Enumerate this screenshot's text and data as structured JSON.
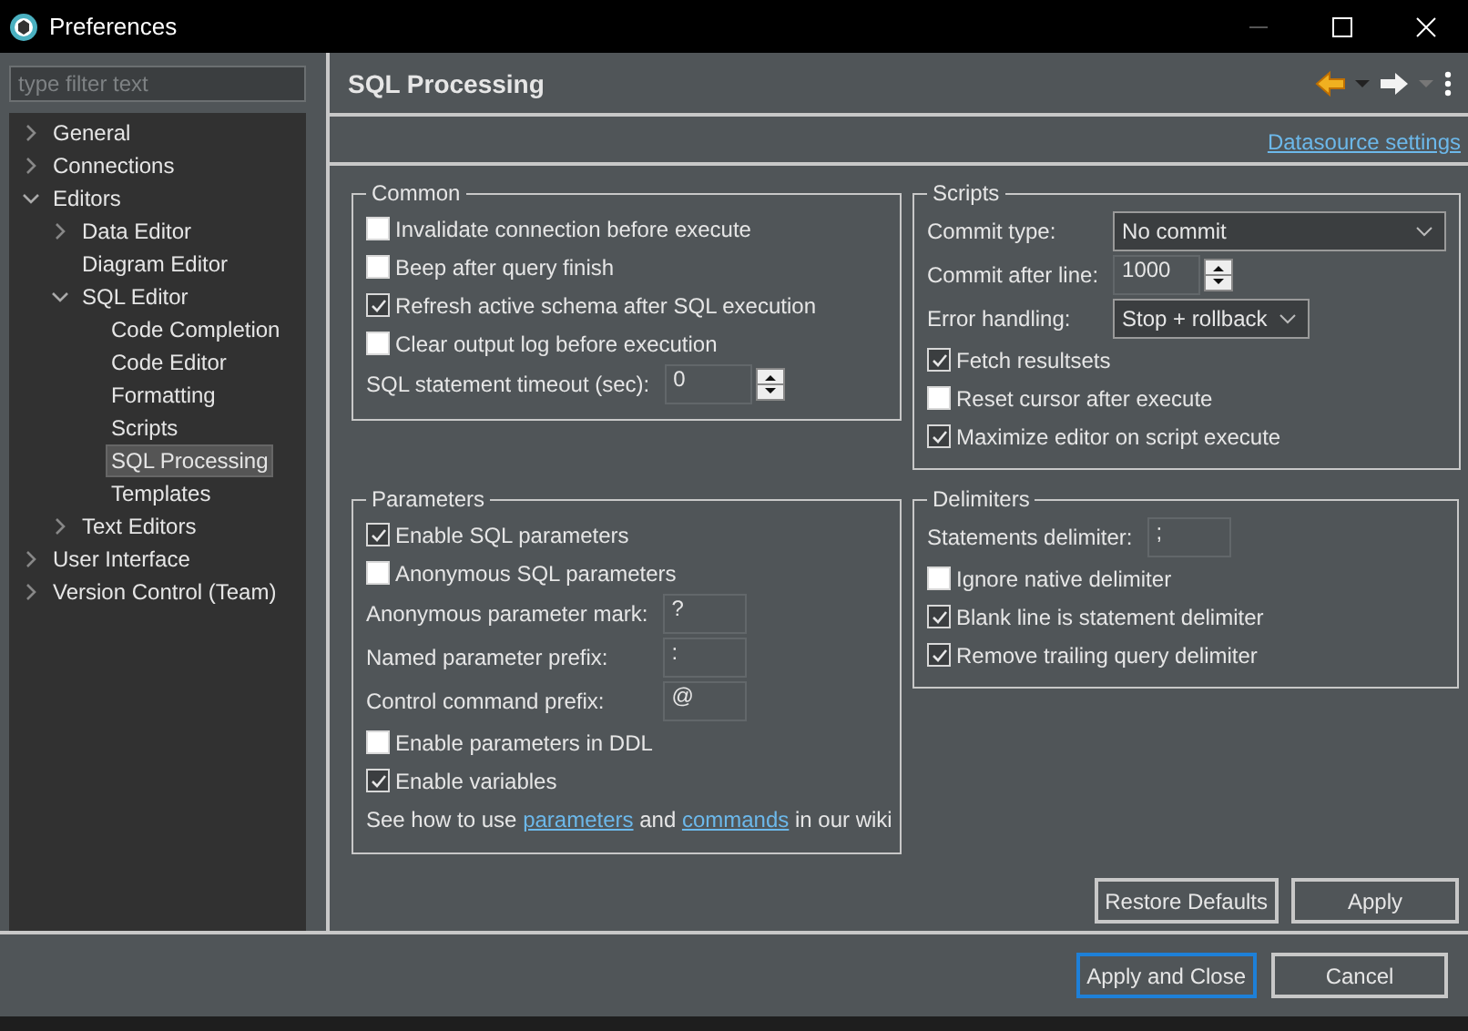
{
  "window": {
    "title": "Preferences"
  },
  "sidebar": {
    "filter": {
      "placeholder": "type filter text"
    },
    "tree": [
      {
        "label": "General",
        "expanded": false,
        "selected": false
      },
      {
        "label": "Connections",
        "expanded": false,
        "selected": false
      },
      {
        "label": "Editors",
        "expanded": true,
        "selected": false,
        "children": [
          {
            "label": "Data Editor",
            "expanded": false,
            "selected": false
          },
          {
            "label": "Diagram Editor",
            "selected": false
          },
          {
            "label": "SQL Editor",
            "expanded": true,
            "selected": false,
            "children": [
              {
                "label": "Code Completion",
                "selected": false
              },
              {
                "label": "Code Editor",
                "selected": false
              },
              {
                "label": "Formatting",
                "selected": false
              },
              {
                "label": "Scripts",
                "selected": false
              },
              {
                "label": "SQL Processing",
                "selected": true
              },
              {
                "label": "Templates",
                "selected": false
              }
            ]
          },
          {
            "label": "Text Editors",
            "expanded": false,
            "selected": false
          }
        ]
      },
      {
        "label": "User Interface",
        "expanded": false,
        "selected": false
      },
      {
        "label": "Version Control (Team)",
        "expanded": false,
        "selected": false
      }
    ]
  },
  "page": {
    "title": "SQL Processing",
    "link": "Datasource settings",
    "groups": [
      {
        "title": "Common",
        "items": [
          {
            "kind": "checkbox",
            "label": "Invalidate connection before execute",
            "checked": false
          },
          {
            "kind": "checkbox",
            "label": "Beep after query finish",
            "checked": false
          },
          {
            "kind": "checkbox",
            "label": "Refresh active schema after SQL execution",
            "checked": true
          },
          {
            "kind": "checkbox",
            "label": "Clear output log before execution",
            "checked": false
          },
          {
            "kind": "spinner",
            "label": "SQL statement timeout (sec):",
            "value": "0"
          }
        ]
      },
      {
        "title": "Scripts",
        "items": [
          {
            "kind": "combo",
            "label": "Commit type:",
            "value": "No commit"
          },
          {
            "kind": "spinner",
            "label": "Commit after line:",
            "value": "1000"
          },
          {
            "kind": "combo",
            "label": "Error handling:",
            "value": "Stop + rollback"
          },
          {
            "kind": "checkbox",
            "label": "Fetch resultsets",
            "checked": true
          },
          {
            "kind": "checkbox",
            "label": "Reset cursor after execute",
            "checked": false
          },
          {
            "kind": "checkbox",
            "label": "Maximize editor on script execute",
            "checked": true
          }
        ]
      },
      {
        "title": "Parameters",
        "items": [
          {
            "kind": "checkbox",
            "label": "Enable SQL parameters",
            "checked": true
          },
          {
            "kind": "checkbox",
            "label": "Anonymous SQL parameters",
            "checked": false
          },
          {
            "kind": "input",
            "label": "Anonymous parameter mark:",
            "value": "?"
          },
          {
            "kind": "input",
            "label": "Named parameter prefix:",
            "value": ":"
          },
          {
            "kind": "input",
            "label": "Control command prefix:",
            "value": "@"
          },
          {
            "kind": "checkbox",
            "label": "Enable parameters in DDL",
            "checked": false
          },
          {
            "kind": "checkbox",
            "label": "Enable variables",
            "checked": true
          },
          {
            "kind": "sentence",
            "parts": [
              {
                "text": "See how to use ",
                "link": false
              },
              {
                "text": "parameters",
                "link": true
              },
              {
                "text": " and ",
                "link": false
              },
              {
                "text": "commands",
                "link": true
              },
              {
                "text": " in our wiki",
                "link": false
              }
            ]
          }
        ]
      },
      {
        "title": "Delimiters",
        "items": [
          {
            "kind": "input",
            "label": "Statements delimiter:",
            "value": ";"
          },
          {
            "kind": "checkbox",
            "label": "Ignore native delimiter",
            "checked": false
          },
          {
            "kind": "checkbox",
            "label": "Blank line is statement delimiter",
            "checked": true
          },
          {
            "kind": "checkbox",
            "label": "Remove trailing query delimiter",
            "checked": true
          }
        ]
      }
    ],
    "buttons": [
      {
        "label": "Restore Defaults"
      },
      {
        "label": "Apply"
      }
    ]
  },
  "footer": {
    "buttons": [
      {
        "label": "Apply and Close",
        "default": true
      },
      {
        "label": "Cancel",
        "default": false
      }
    ]
  }
}
